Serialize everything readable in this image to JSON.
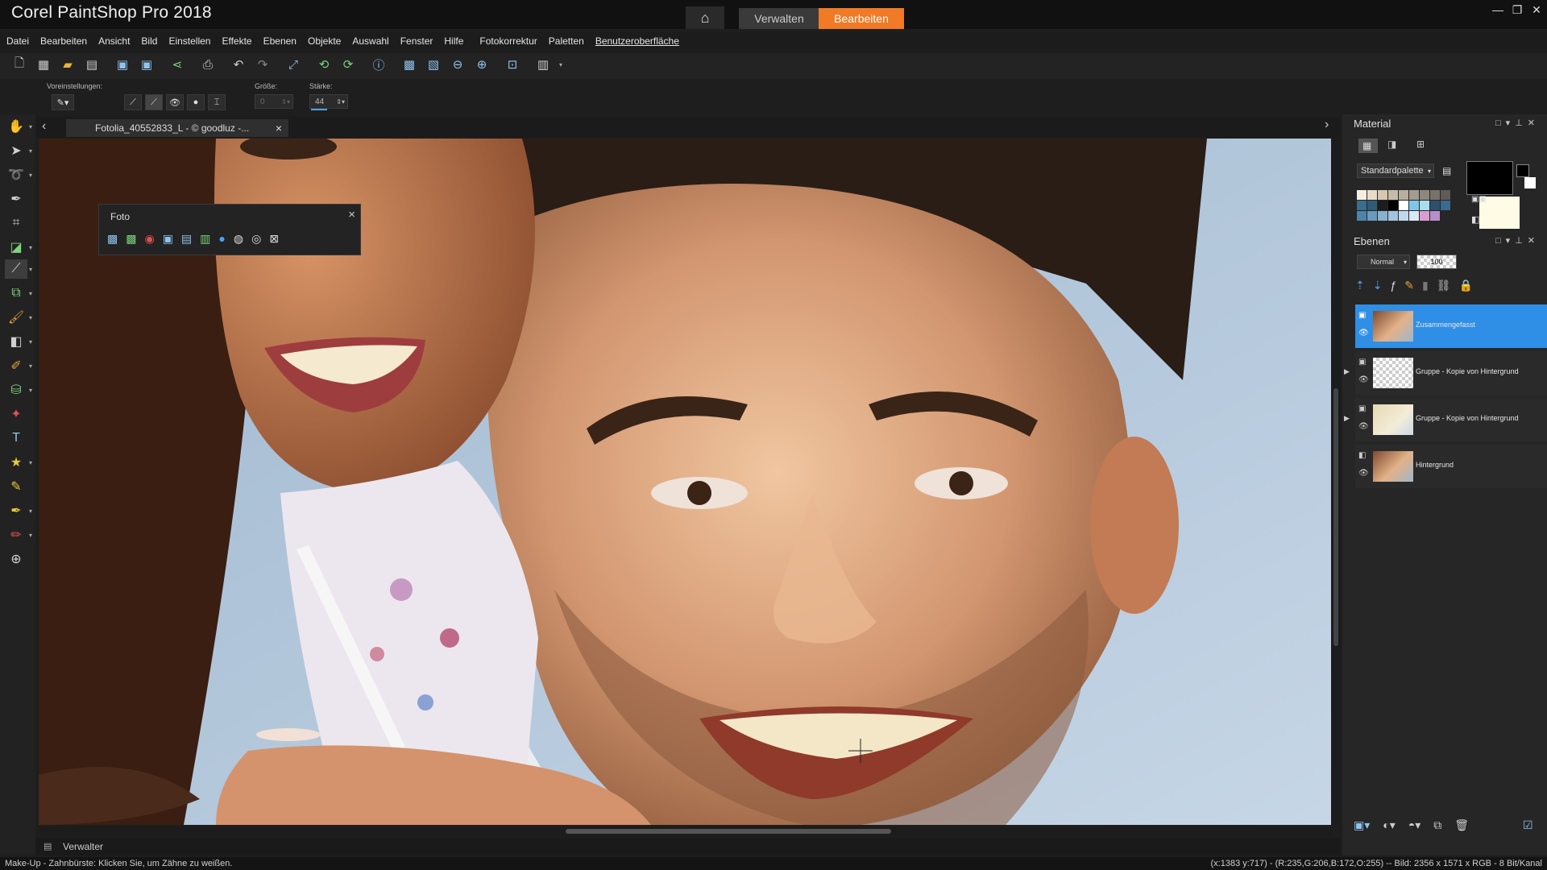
{
  "app": {
    "title": "Corel PaintShop Pro 2018",
    "workspace_tabs": [
      "Verwalten",
      "Bearbeiten"
    ],
    "active_tab": "Bearbeiten",
    "accent_color": "#f07a26",
    "window_controls": [
      "minimize-icon",
      "restore-icon",
      "close-icon"
    ]
  },
  "menu": [
    "Datei",
    "Bearbeiten",
    "Ansicht",
    "Bild",
    "Einstellen",
    "Effekte",
    "Ebenen",
    "Objekte",
    "Auswahl",
    "Fenster",
    "Hilfe",
    "Fotokorrektur",
    "Paletten",
    "Benutzeroberfläche"
  ],
  "toolbar_icons": [
    "new-icon",
    "browse-icon",
    "open-icon",
    "scan-icon",
    "save-icon",
    "save-as-icon",
    "share-icon",
    "print-icon",
    "undo-icon",
    "redo-icon",
    "resize-icon",
    "rotate-left-icon",
    "rotate-right-icon",
    "info-icon",
    "fit-window-icon",
    "actual-size-icon",
    "zoom-out-icon",
    "zoom-in-icon",
    "zoom-fit-icon",
    "paste-icon"
  ],
  "tool_options": {
    "presets_label": "Voreinstellungen:",
    "size_label": "Größe:",
    "size_value": "0",
    "strength_label": "Stärke:",
    "strength_value": "44"
  },
  "document": {
    "tab_title": "Fotolia_40552833_L - © goodluz -...",
    "close_symbol": "×",
    "nav_prev": "‹",
    "nav_next": "›"
  },
  "foto_palette": {
    "title": "Foto",
    "close_symbol": "×",
    "icons": [
      "smart-photo-fix-icon",
      "one-step-photo-fix-icon",
      "red-eye-icon",
      "retouch-icon",
      "hdr-icon",
      "panorama-icon",
      "depth-of-field-icon",
      "vignette-icon",
      "makeover-icon",
      "lens-icon"
    ]
  },
  "material_panel": {
    "title": "Material",
    "palette_select": "Standardpalette",
    "foreground_color": "#000000",
    "background_color": "#fffbe5",
    "swatches": [
      "#f3efe3",
      "#e8dcc7",
      "#d4c8b3",
      "#c6bca9",
      "#b6ae9f",
      "#a39b90",
      "#8d877e",
      "#77726b",
      "#5f5b56",
      "#3a6e8a",
      "#2e5c74",
      "#1d1d1d",
      "#000000",
      "#ffffff",
      "#7fc7e8",
      "#a6dff0",
      "#2f4f6b",
      "#3a6a8f",
      "#4f84a8",
      "#6a9bbd",
      "#87b1cf",
      "#a2c4df",
      "#c0d8ec",
      "#dbe8f4",
      "#d89fd0",
      "#b88fc8"
    ]
  },
  "layers_panel": {
    "title": "Ebenen",
    "blend_mode": "Normal",
    "opacity": "100",
    "layers": [
      {
        "name": "Zusammengefasst",
        "selected": true
      },
      {
        "name": "Gruppe - Kopie von Hintergrund",
        "selected": false
      },
      {
        "name": "Gruppe - Kopie von Hintergrund",
        "selected": false
      },
      {
        "name": "Hintergrund",
        "selected": false
      }
    ]
  },
  "bottom": {
    "verwalter_label": "Verwalter",
    "status_left": "Make-Up - Zahnbürste: Klicken Sie, um Zähne zu weißen.",
    "status_right": "(x:1383 y:717) - (R:235,G:206,B:172,O:255) -- Bild: 2356 x 1571 x RGB - 8 Bit/Kanal"
  }
}
